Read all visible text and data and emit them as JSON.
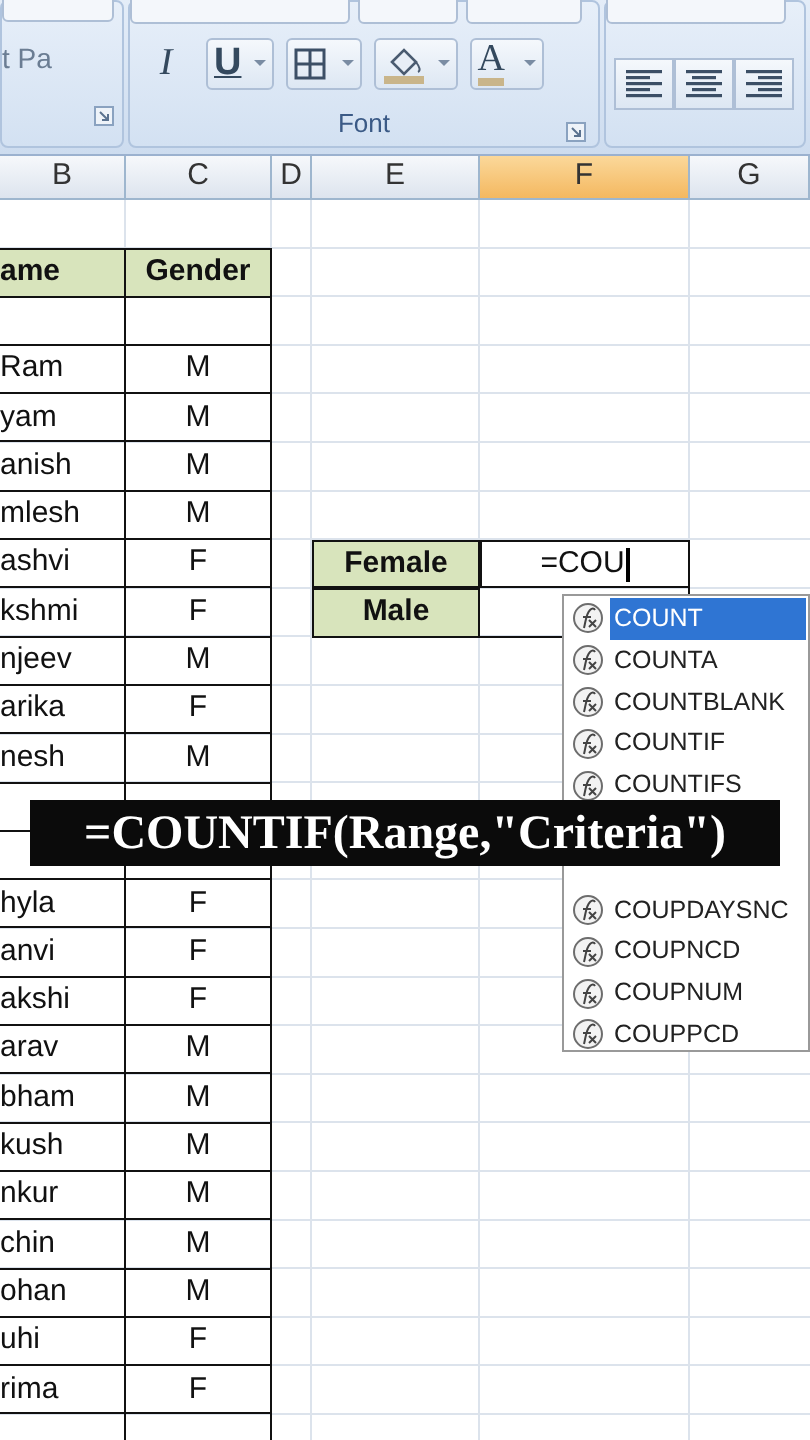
{
  "ribbon": {
    "left_text": "t Pa",
    "group_label": "Font",
    "buttons": [
      {
        "kind": "italic",
        "label": "I"
      },
      {
        "kind": "underline",
        "label": "U"
      },
      {
        "kind": "borders"
      },
      {
        "kind": "fill"
      },
      {
        "kind": "font_color",
        "label": "A"
      },
      {
        "kind": "align_left"
      },
      {
        "kind": "align_center"
      },
      {
        "kind": "align_right"
      }
    ]
  },
  "columns": [
    {
      "label": "B",
      "selected": false
    },
    {
      "label": "C",
      "selected": false
    },
    {
      "label": "D",
      "selected": false
    },
    {
      "label": "E",
      "selected": false
    },
    {
      "label": "F",
      "selected": true
    },
    {
      "label": "G",
      "selected": false
    }
  ],
  "table": {
    "header": {
      "name": "ame",
      "gender": "Gender"
    },
    "rows_top": [
      {
        "name": "Ram",
        "gender": "M"
      },
      {
        "name": "yam",
        "gender": "M"
      },
      {
        "name": "anish",
        "gender": "M"
      },
      {
        "name": "mlesh",
        "gender": "M"
      },
      {
        "name": "ashvi",
        "gender": "F"
      },
      {
        "name": "kshmi",
        "gender": "F"
      },
      {
        "name": "njeev",
        "gender": "M"
      },
      {
        "name": "arika",
        "gender": "F"
      },
      {
        "name": "nesh",
        "gender": "M"
      }
    ],
    "rows_bottom": [
      {
        "name": "hyla",
        "gender": "F"
      },
      {
        "name": "anvi",
        "gender": "F"
      },
      {
        "name": "akshi",
        "gender": "F"
      },
      {
        "name": "arav",
        "gender": "M"
      },
      {
        "name": "bham",
        "gender": "M"
      },
      {
        "name": "kush",
        "gender": "M"
      },
      {
        "name": "nkur",
        "gender": "M"
      },
      {
        "name": "chin",
        "gender": "M"
      },
      {
        "name": "ohan",
        "gender": "M"
      },
      {
        "name": "uhi",
        "gender": "F"
      },
      {
        "name": "rima",
        "gender": "F"
      }
    ]
  },
  "summary": [
    {
      "label": "Female",
      "value": "=COU"
    },
    {
      "label": "Male"
    }
  ],
  "autocomplete": {
    "items_top": [
      {
        "label": "COUNT",
        "selected": true
      },
      {
        "label": "COUNTA",
        "selected": false
      },
      {
        "label": "COUNTBLANK",
        "selected": false
      },
      {
        "label": "COUNTIF",
        "selected": false
      },
      {
        "label": "COUNTIFS",
        "selected": false
      }
    ],
    "items_bottom": [
      {
        "label": "COUPDAYSNC",
        "selected": false
      },
      {
        "label": "COUPNCD",
        "selected": false
      },
      {
        "label": "COUPNUM",
        "selected": false
      },
      {
        "label": "COUPPCD",
        "selected": false
      }
    ]
  },
  "caption": {
    "text": "=COUNTIF(Range,\"Criteria\")"
  }
}
